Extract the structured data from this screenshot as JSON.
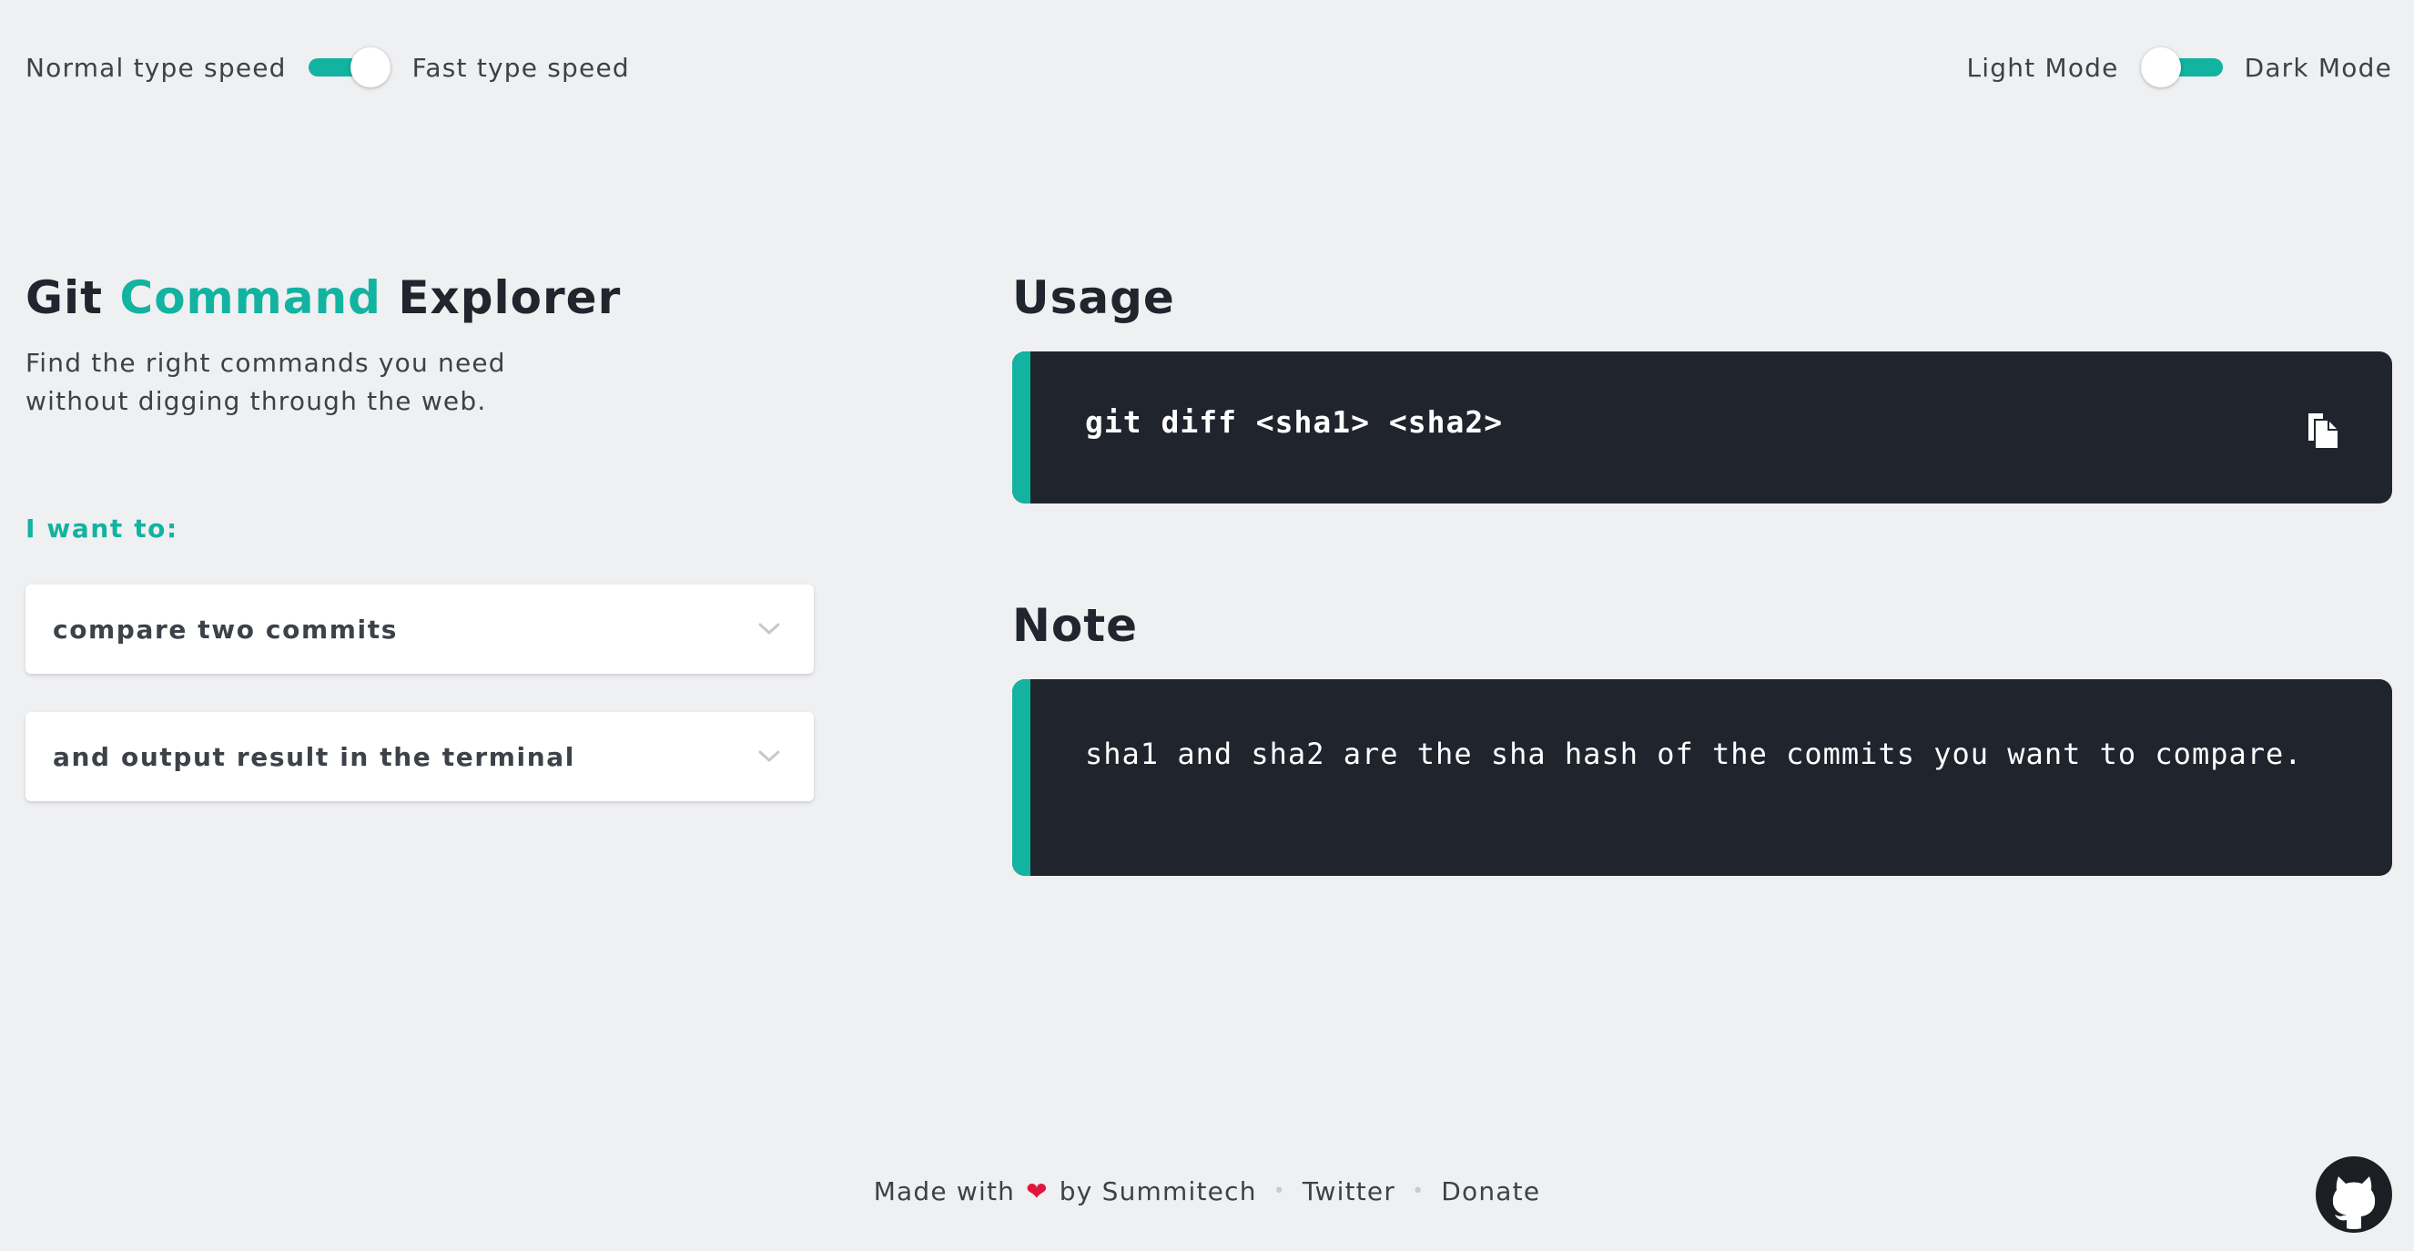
{
  "toggles": {
    "speed": {
      "left_label": "Normal type speed",
      "right_label": "Fast type speed",
      "state": "on"
    },
    "theme": {
      "left_label": "Light Mode",
      "right_label": "Dark Mode",
      "state": "off"
    }
  },
  "header": {
    "title_part1": "Git",
    "title_accent": "Command",
    "title_part2": "Explorer",
    "subtitle_line1": "Find the right commands you need",
    "subtitle_line2": "without digging through the web."
  },
  "form": {
    "label": "I want to:",
    "primary_option": "compare two commits",
    "secondary_option": "and output result in the terminal"
  },
  "usage": {
    "title": "Usage",
    "command": "git diff <sha1> <sha2>"
  },
  "note": {
    "title": "Note",
    "text": "sha1 and sha2 are the sha hash of the commits you want to compare."
  },
  "footer": {
    "made_with": "Made with",
    "heart": "❤",
    "by": "by Summitech",
    "twitter": "Twitter",
    "donate": "Donate",
    "separator": "•"
  },
  "colors": {
    "accent": "#12b3a0",
    "background": "#eff0f2",
    "code_background": "#1f242d",
    "heart": "#e0173c"
  },
  "icons": {
    "copy": "clipboard-copy-icon",
    "chevron": "chevron-down-icon",
    "github": "github-octocat-icon"
  }
}
